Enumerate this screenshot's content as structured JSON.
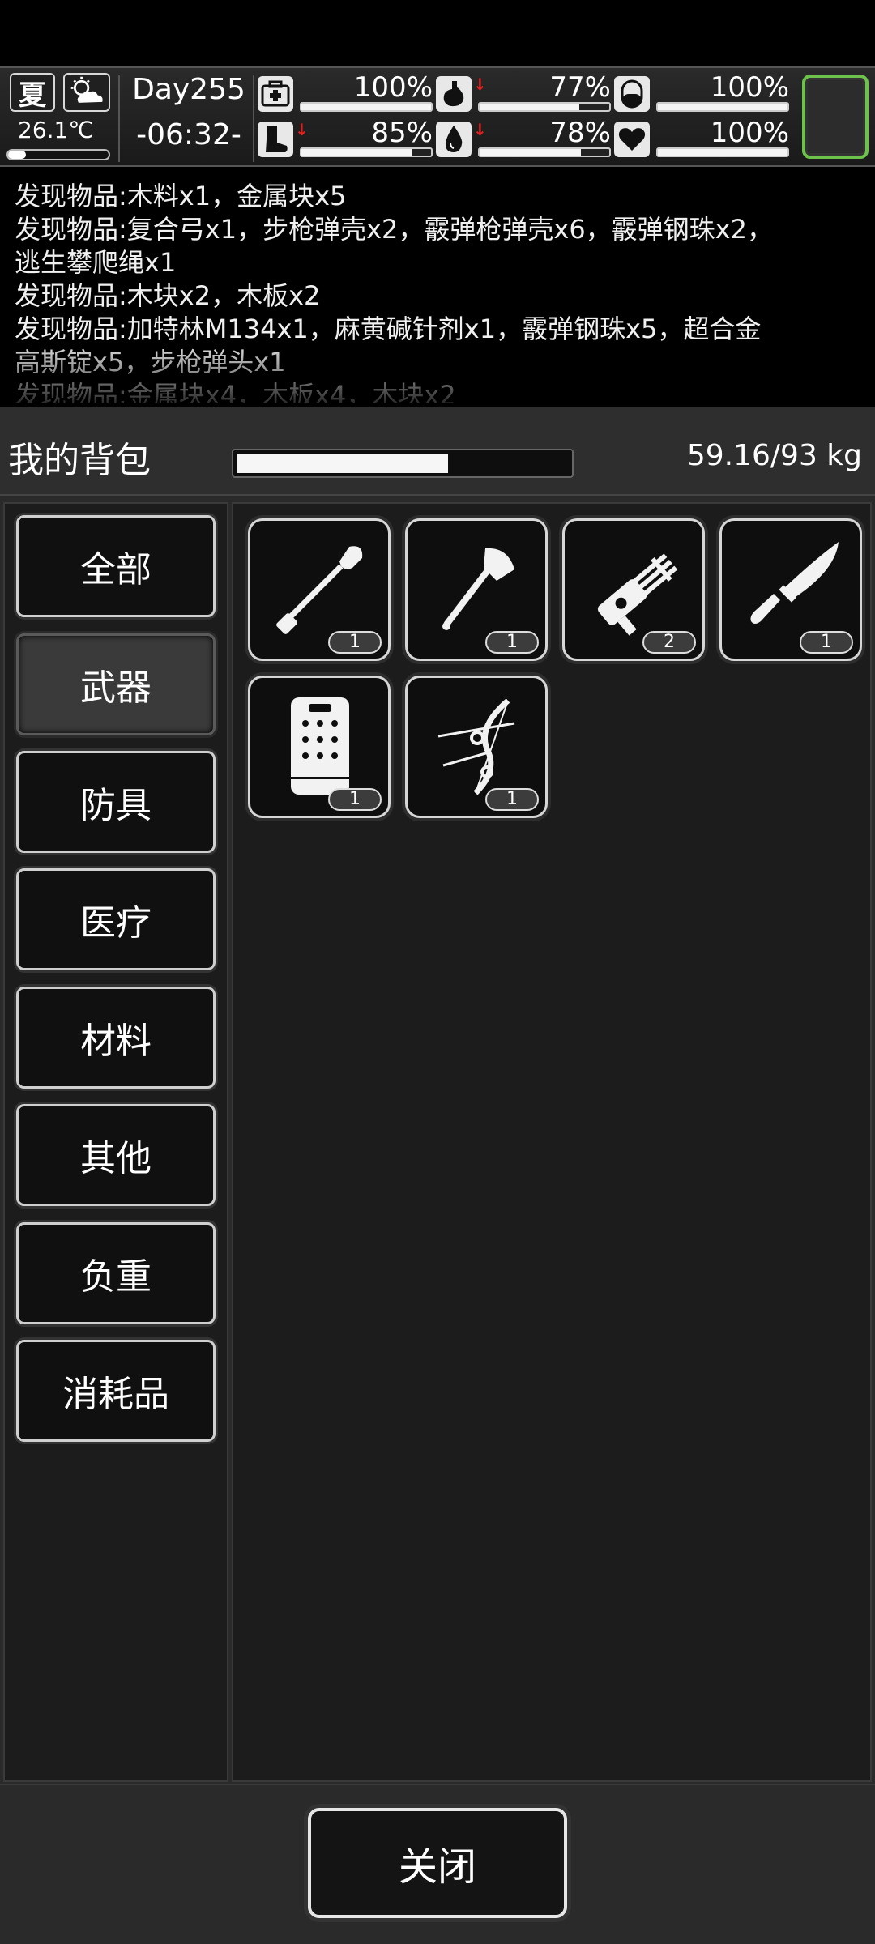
{
  "hud": {
    "season": "夏",
    "weather_icon": "partly-cloudy-icon",
    "temperature": "26.1℃",
    "temperature_level": 0.18,
    "day": "Day255",
    "time": "-06:32-",
    "stats": [
      {
        "key": "health",
        "icon": "medkit-icon",
        "value": "100%",
        "level": 1.0,
        "falling": false
      },
      {
        "key": "hunger",
        "icon": "stomach-icon",
        "value": "77%",
        "level": 0.77,
        "falling": true
      },
      {
        "key": "energy",
        "icon": "pill-icon",
        "value": "100%",
        "level": 1.0,
        "falling": false
      },
      {
        "key": "stamina",
        "icon": "boot-icon",
        "value": "85%",
        "level": 0.85,
        "falling": true
      },
      {
        "key": "thirst",
        "icon": "water-drop-icon",
        "value": "78%",
        "level": 0.78,
        "falling": true
      },
      {
        "key": "mood",
        "icon": "heart-icon",
        "value": "100%",
        "level": 1.0,
        "falling": false
      }
    ],
    "equip_slot_color": "#6cc24a"
  },
  "log": {
    "lines": [
      "发现物品:木料x1，金属块x5",
      "发现物品:复合弓x1，步枪弹壳x2，霰弹枪弹壳x6，霰弹钢珠x2，",
      "逃生攀爬绳x1",
      "发现物品:木块x2，木板x2",
      "发现物品:加特林M134x1，麻黄碱针剂x1，霰弹钢珠x5，超合金",
      "高斯锭x5，步枪弹头x1",
      "发现物品:金属块x4，木板x4，木块x2"
    ]
  },
  "backpack": {
    "title": "我的背包",
    "weight": "59.16/93 kg",
    "weight_level": 0.636
  },
  "categories": [
    {
      "label": "全部",
      "active": false
    },
    {
      "label": "武器",
      "active": true
    },
    {
      "label": "防具",
      "active": false
    },
    {
      "label": "医疗",
      "active": false
    },
    {
      "label": "材料",
      "active": false
    },
    {
      "label": "其他",
      "active": false
    },
    {
      "label": "负重",
      "active": false
    },
    {
      "label": "消耗品",
      "active": false
    }
  ],
  "items": [
    {
      "icon": "shovel-icon",
      "qty": "1"
    },
    {
      "icon": "axe-icon",
      "qty": "1"
    },
    {
      "icon": "minigun-icon",
      "qty": "2"
    },
    {
      "icon": "knife-icon",
      "qty": "1"
    },
    {
      "icon": "riot-shield-icon",
      "qty": "1"
    },
    {
      "icon": "compound-bow-icon",
      "qty": "1"
    }
  ],
  "footer": {
    "close_label": "关闭"
  }
}
